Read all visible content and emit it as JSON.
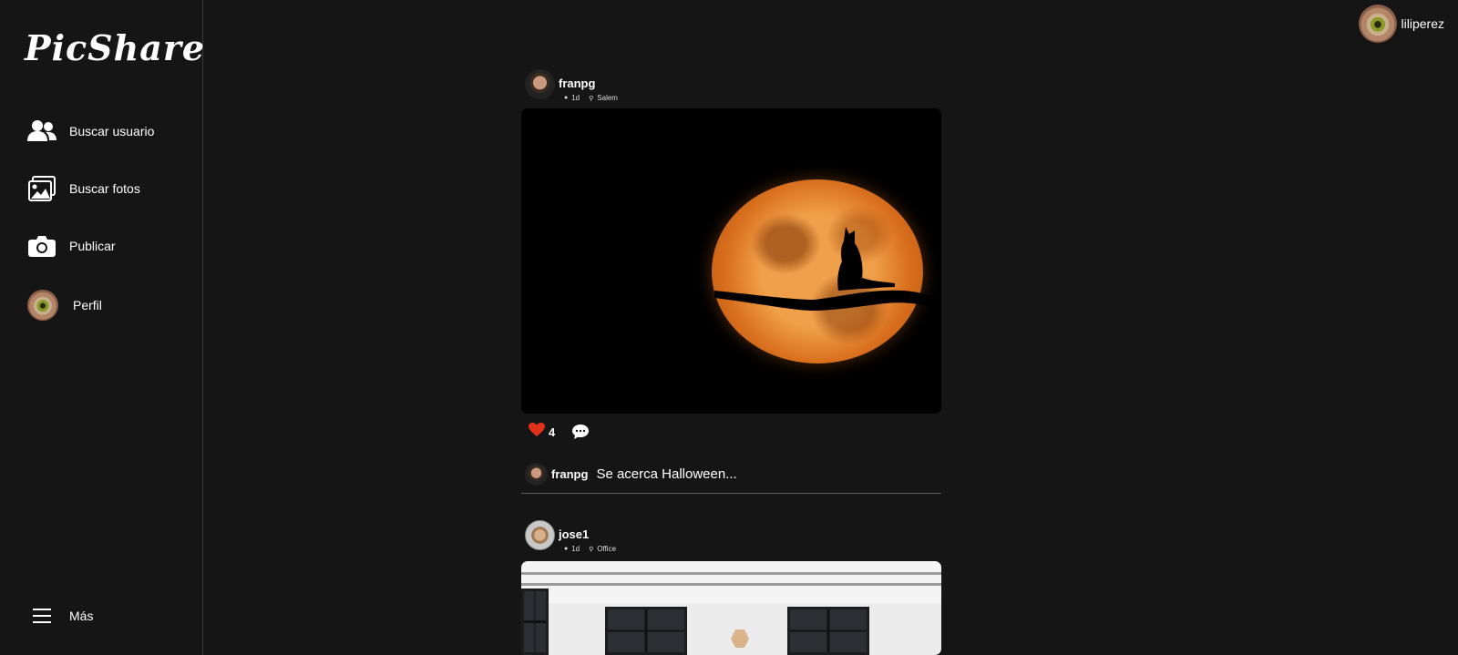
{
  "app": {
    "name": "PicShare"
  },
  "sidebar": {
    "items": [
      {
        "label": "Buscar usuario",
        "icon": "users-icon"
      },
      {
        "label": "Buscar fotos",
        "icon": "images-icon"
      },
      {
        "label": "Publicar",
        "icon": "camera-icon"
      },
      {
        "label": "Perfil",
        "icon": "profile-avatar"
      }
    ],
    "more": {
      "label": "Más",
      "icon": "menu-icon"
    }
  },
  "current_user": {
    "username": "liliperez"
  },
  "feed": {
    "posts": [
      {
        "username": "franpg",
        "time": "1d",
        "location": "Salem",
        "photo": "moon-cat-photo",
        "likes": "4",
        "liked": true,
        "caption_user": "franpg",
        "caption": "Se acerca Halloween..."
      },
      {
        "username": "jose1",
        "time": "1d",
        "location": "Office",
        "photo": "office-photo"
      }
    ]
  },
  "colors": {
    "background": "#151515",
    "text": "#ffffff",
    "like": "#e0311b",
    "divider": "#5a5a5a"
  }
}
